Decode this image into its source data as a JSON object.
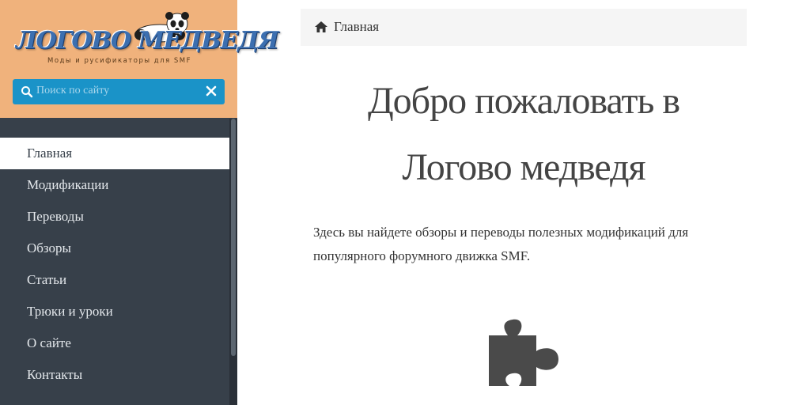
{
  "sidebar": {
    "logo": {
      "title": "ЛОГОВО МЕДВЕДЯ",
      "tagline": "Моды и русификаторы для SMF"
    },
    "search": {
      "placeholder": "Поиск по сайту",
      "value": ""
    },
    "items": [
      {
        "label": "Главная",
        "active": true
      },
      {
        "label": "Модификации"
      },
      {
        "label": "Переводы"
      },
      {
        "label": "Обзоры"
      },
      {
        "label": "Статьи"
      },
      {
        "label": "Трюки и уроки"
      },
      {
        "label": "О сайте"
      },
      {
        "label": "Контакты"
      }
    ]
  },
  "breadcrumb": {
    "icon": "home-icon",
    "label": "Главная"
  },
  "main": {
    "title_line1": "Добро пожаловать в",
    "title_line2": "Логово медведя",
    "intro_line1": "Здесь вы найдете обзоры и переводы полезных модификаций для",
    "intro_line2": "популярного форумного движка SMF.",
    "feature_icon": "puzzle-icon"
  },
  "colors": {
    "sidebar_bg": "#37404a",
    "header_bg": "#f0b27c",
    "search_bg": "#1a93c8",
    "text": "#444444"
  }
}
